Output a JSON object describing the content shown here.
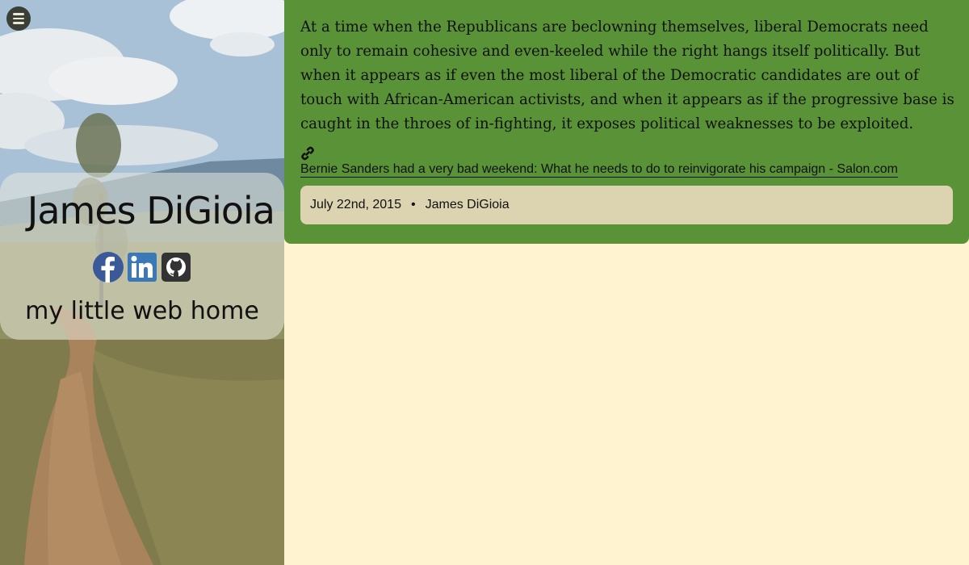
{
  "menu": {
    "icon": "hamburger-menu-icon"
  },
  "site": {
    "title": "James DiGioia",
    "tagline": "my little web home",
    "social": [
      {
        "name": "facebook",
        "icon": "facebook-icon",
        "color": "#3b5998"
      },
      {
        "name": "linkedin",
        "icon": "linkedin-icon",
        "color": "#3b78b7"
      },
      {
        "name": "github",
        "icon": "github-icon",
        "color": "#333333"
      }
    ]
  },
  "post": {
    "body": "At a time when the Republicans are beclowning themselves, liberal Democrats need only to remain cohesive and even-keeled while the right hangs itself politically. But when it appears as if even the most liberal of the Democratic candidates are out of touch with African-American activists, and when it appears as if the progressive base is caught in the throes of in-fighting, it exposes political weaknesses to be exploited.",
    "link_icon": "link-icon",
    "link_text": "Bernie Sanders had a very bad weekend: What he needs to do to reinvigorate his campaign - Salon.com",
    "date": "July 22nd, 2015",
    "separator": "•",
    "author": "James DiGioia"
  },
  "colors": {
    "page_background": "#fff4cf",
    "card_green": "#5a9337",
    "meta_background": "#dcd3b0"
  }
}
